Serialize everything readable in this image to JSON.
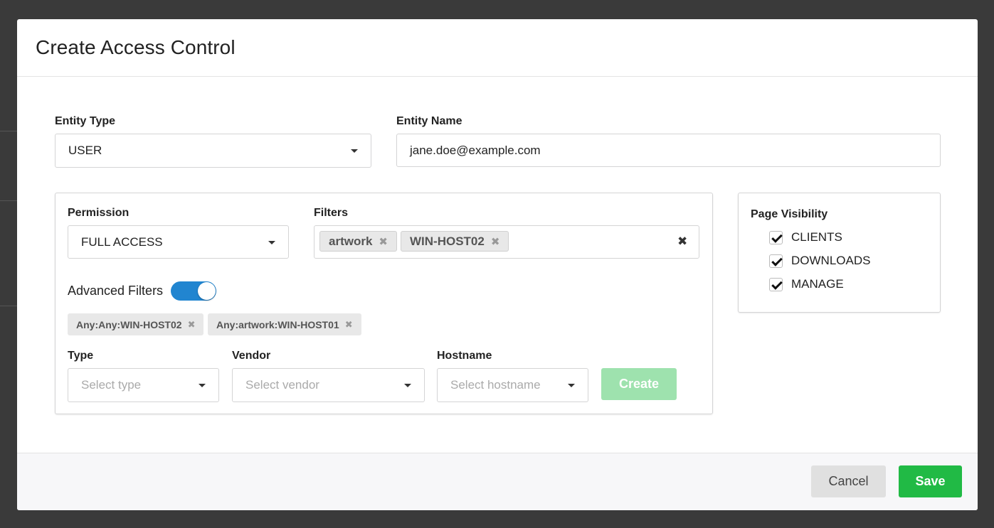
{
  "modal": {
    "title": "Create Access Control",
    "entity_type": {
      "label": "Entity Type",
      "value": "USER"
    },
    "entity_name": {
      "label": "Entity Name",
      "value": "jane.doe@example.com"
    },
    "permission": {
      "label": "Permission",
      "value": "FULL ACCESS"
    },
    "filters": {
      "label": "Filters",
      "chips": [
        "artwork",
        "WIN-HOST02"
      ]
    },
    "advanced_filters": {
      "label": "Advanced Filters",
      "enabled": true,
      "tags": [
        "Any:Any:WIN-HOST02",
        "Any:artwork:WIN-HOST01"
      ]
    },
    "type": {
      "label": "Type",
      "placeholder": "Select type"
    },
    "vendor": {
      "label": "Vendor",
      "placeholder": "Select vendor"
    },
    "hostname": {
      "label": "Hostname",
      "placeholder": "Select hostname"
    },
    "create_label": "Create",
    "page_visibility": {
      "label": "Page Visibility",
      "items": [
        {
          "label": "CLIENTS",
          "checked": true
        },
        {
          "label": "DOWNLOADS",
          "checked": true
        },
        {
          "label": "MANAGE",
          "checked": true
        }
      ]
    },
    "footer": {
      "cancel_label": "Cancel",
      "save_label": "Save"
    }
  },
  "colors": {
    "primary": "#2185d0",
    "success": "#21ba45",
    "success_disabled": "#9ee2ae"
  },
  "icons": {
    "dropdown": "caret-down-icon",
    "remove": "close-icon",
    "check": "check-icon"
  }
}
